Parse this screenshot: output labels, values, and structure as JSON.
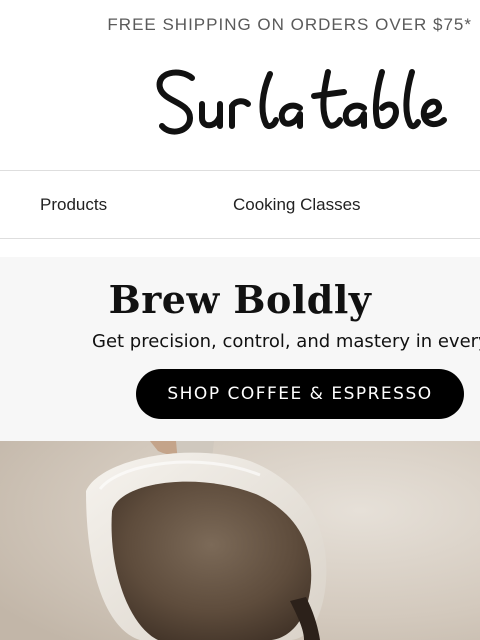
{
  "promo": {
    "text": "FREE SHIPPING ON ORDERS OVER $75*"
  },
  "brand": {
    "logo_text": "Sur la table"
  },
  "nav": {
    "items": [
      {
        "label": "Products"
      },
      {
        "label": "Cooking Classes"
      }
    ]
  },
  "hero": {
    "title": "Brew Boldly",
    "subtitle": "Get precision, control, and mastery in every c",
    "cta_label": "SHOP COFFEE & ESPRESSO"
  },
  "colors": {
    "promo_text": "#5a5a5a",
    "hero_bg": "#f7f7f7",
    "cta_bg": "#000000",
    "cta_text": "#ffffff"
  },
  "image": {
    "subject": "pitcher-pouring-coffee-image"
  }
}
